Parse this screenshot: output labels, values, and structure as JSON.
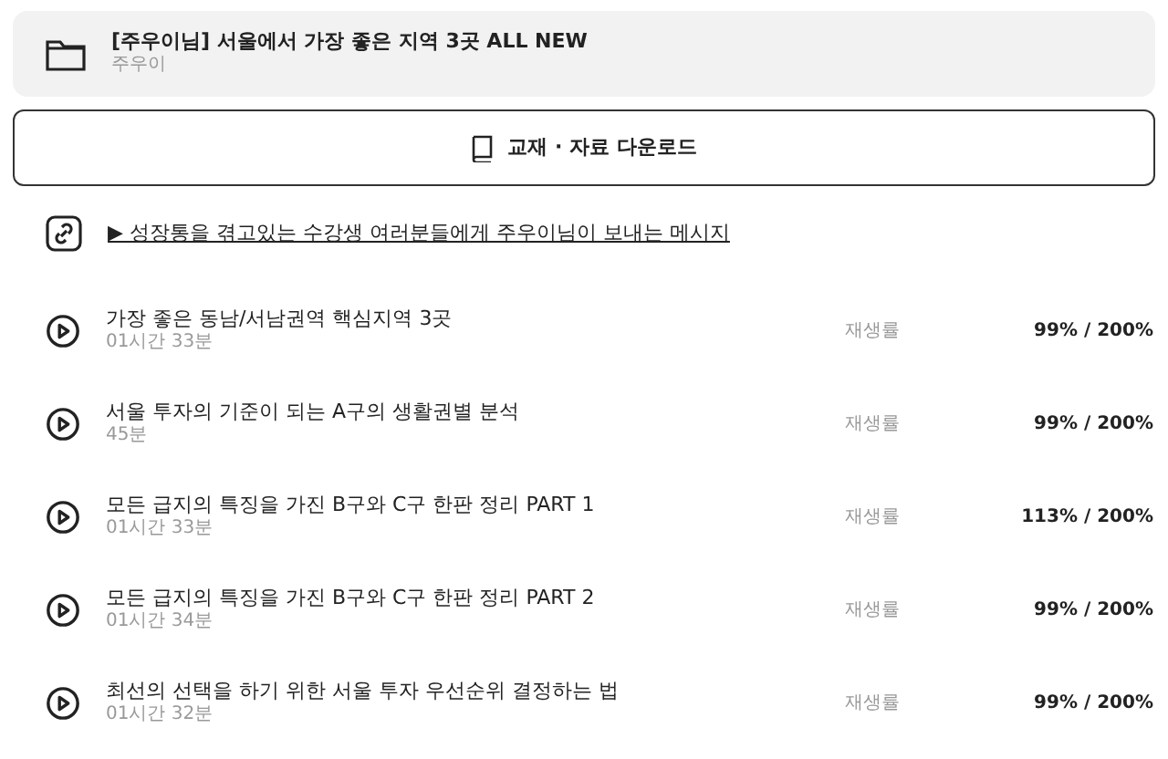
{
  "course": {
    "title": "[주우이님] 서울에서 가장 좋은 지역 3곳 ALL NEW",
    "instructor": "주우이"
  },
  "download_button": {
    "label": "교재 · 자료 다운로드"
  },
  "message_link": {
    "label": "▶ 성장통을 겪고있는 수강생 여러분들에게 주우이님이 보내는 메시지"
  },
  "lessons": [
    {
      "title": "가장 좋은 동남/서남권역 핵심지역 3곳",
      "duration": "01시간 33분",
      "rate_label": "재생률",
      "rate": "99% / 200%"
    },
    {
      "title": "서울 투자의 기준이 되는 A구의 생활권별 분석",
      "duration": "45분",
      "rate_label": "재생률",
      "rate": "99% / 200%"
    },
    {
      "title": "모든 급지의 특징을 가진 B구와 C구 한판 정리 PART 1",
      "duration": "01시간 33분",
      "rate_label": "재생률",
      "rate": "113% / 200%"
    },
    {
      "title": "모든 급지의 특징을 가진 B구와 C구 한판 정리 PART 2",
      "duration": "01시간 34분",
      "rate_label": "재생률",
      "rate": "99% / 200%"
    },
    {
      "title": "최선의 선택을 하기 위한 서울 투자 우선순위 결정하는 법",
      "duration": "01시간 32분",
      "rate_label": "재생률",
      "rate": "99% / 200%"
    }
  ]
}
